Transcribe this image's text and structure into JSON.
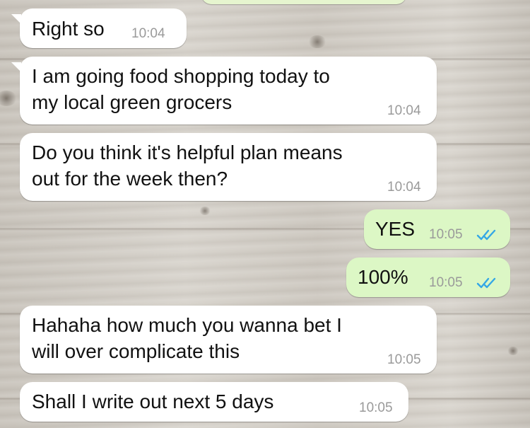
{
  "theme": {
    "incoming_bubble_color": "#ffffff",
    "outgoing_bubble_color": "#dcf7c5",
    "timestamp_color": "#9a9a9a",
    "read_receipt_color": "#34a7e6",
    "background": "wood-planks"
  },
  "messages": [
    {
      "direction": "incoming",
      "text": "Right so",
      "time": "10:04"
    },
    {
      "direction": "incoming",
      "text": "I am going food shopping today to\nmy local green grocers",
      "time": "10:04"
    },
    {
      "direction": "incoming",
      "text": "Do you think it's helpful plan means\nout for the week then?",
      "time": "10:04"
    },
    {
      "direction": "outgoing",
      "text": "YES",
      "time": "10:05",
      "status_icon": "double-check-read-icon"
    },
    {
      "direction": "outgoing",
      "text": "100%",
      "time": "10:05",
      "status_icon": "double-check-read-icon"
    },
    {
      "direction": "incoming",
      "text": "Hahaha how much you wanna bet I\nwill over complicate this",
      "time": "10:05"
    },
    {
      "direction": "incoming",
      "text": "Shall I write out next 5 days",
      "time": "10:05"
    }
  ]
}
